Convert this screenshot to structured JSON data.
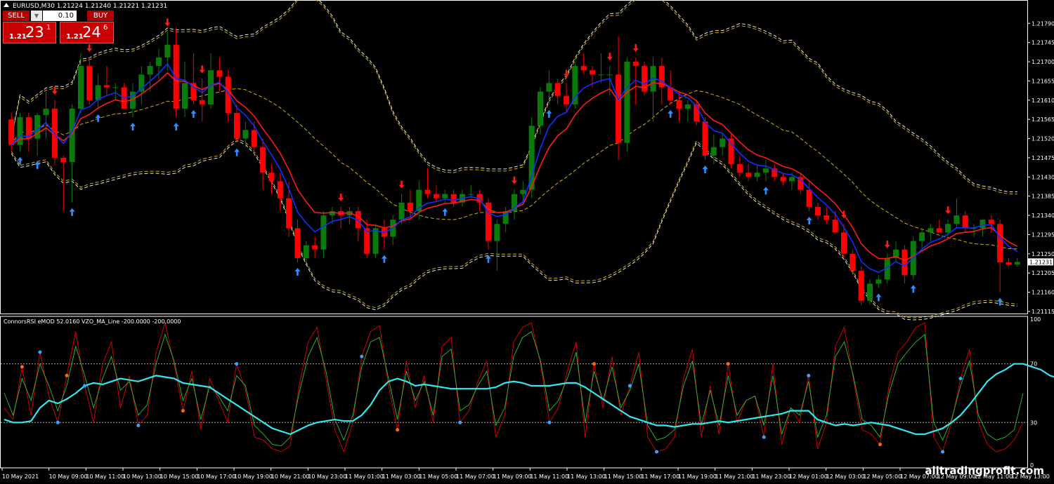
{
  "header": {
    "symbol_info": "EURUSD,M30  1.21224 1.21240 1.21221 1.21231",
    "indicator_info": "ConnorsRSI eMOD 52.0160  VZO_MA_Line -200.0000 -200.0000"
  },
  "trade_panel": {
    "sell_label": "SELL",
    "buy_label": "BUY",
    "lot": "0.10",
    "sell_small": "1.21",
    "sell_big": "23",
    "sell_sup": "1",
    "buy_small": "1.21",
    "buy_big": "24",
    "buy_sup": "6"
  },
  "current_price_label": "1.21231",
  "watermark": "alltradingprofit.com",
  "colors": {
    "bull": "#0a7a0a",
    "bear": "#ff0000",
    "ma_red": "#ff1a1a",
    "ma_blue": "#1030ff",
    "band_yellow": "#d4b000",
    "band_white": "#e8e8e8",
    "up_arrow": "#2f8fff",
    "down_arrow": "#ff1a1a",
    "vzo": "#33e6f0",
    "crsi_red": "#e00000",
    "crsi_green": "#2fbf2f"
  },
  "chart_data": [
    {
      "type": "candlestick",
      "price_axis": [
        "1.21790",
        "1.21745",
        "1.21700",
        "1.21655",
        "1.21610",
        "1.21565",
        "1.21520",
        "1.21475",
        "1.21430",
        "1.21385",
        "1.21340",
        "1.21295",
        "1.21250",
        "1.21205",
        "1.21160",
        "1.21115"
      ],
      "time_axis": [
        "10 May 2021",
        "10 May 09:00",
        "10 May 11:00",
        "10 May 13:00",
        "10 May 15:00",
        "10 May 17:00",
        "10 May 19:00",
        "10 May 21:00",
        "10 May 23:00",
        "11 May 01:00",
        "11 May 03:00",
        "11 May 05:00",
        "11 May 07:00",
        "11 May 09:00",
        "11 May 11:00",
        "11 May 13:00",
        "11 May 15:00",
        "11 May 17:00",
        "11 May 19:00",
        "11 May 21:00",
        "11 May 23:00",
        "12 May 01:00",
        "12 May 03:00",
        "12 May 05:00",
        "12 May 07:00",
        "12 May 09:00",
        "12 May 11:00",
        "12 May 13:00"
      ],
      "ylim": [
        1.2111,
        1.2182
      ],
      "candles": [
        [
          1.21565,
          1.2158,
          1.2149,
          1.21505
        ],
        [
          1.21505,
          1.2158,
          1.2149,
          1.2157
        ],
        [
          1.2157,
          1.2158,
          1.2149,
          1.2152
        ],
        [
          1.2152,
          1.2158,
          1.2148,
          1.21575
        ],
        [
          1.21575,
          1.2163,
          1.2152,
          1.2159
        ],
        [
          1.2159,
          1.2161,
          1.2146,
          1.21475
        ],
        [
          1.21475,
          1.2148,
          1.2135,
          1.21465
        ],
        [
          1.21465,
          1.216,
          1.2137,
          1.2159
        ],
        [
          1.2159,
          1.2172,
          1.2158,
          1.2169
        ],
        [
          1.2169,
          1.2171,
          1.216,
          1.2161
        ],
        [
          1.2161,
          1.2167,
          1.2159,
          1.21645
        ],
        [
          1.21645,
          1.2169,
          1.2162,
          1.2164
        ],
        [
          1.2164,
          1.2165,
          1.2161,
          1.2164
        ],
        [
          1.2164,
          1.2165,
          1.2159,
          1.2159
        ],
        [
          1.2159,
          1.2165,
          1.2157,
          1.2163
        ],
        [
          1.2163,
          1.2169,
          1.216,
          1.2167
        ],
        [
          1.2167,
          1.217,
          1.2163,
          1.2169
        ],
        [
          1.2169,
          1.2173,
          1.2166,
          1.2171
        ],
        [
          1.2171,
          1.2177,
          1.2168,
          1.2174
        ],
        [
          1.2174,
          1.2178,
          1.2157,
          1.2159
        ],
        [
          1.2159,
          1.217,
          1.2157,
          1.2165
        ],
        [
          1.2165,
          1.2172,
          1.216,
          1.2161
        ],
        [
          1.2161,
          1.2166,
          1.2156,
          1.216
        ],
        [
          1.216,
          1.2172,
          1.2159,
          1.2168
        ],
        [
          1.2168,
          1.2171,
          1.2163,
          1.21665
        ],
        [
          1.21665,
          1.2168,
          1.2156,
          1.2158
        ],
        [
          1.2158,
          1.216,
          1.2151,
          1.2152
        ],
        [
          1.2152,
          1.2156,
          1.215,
          1.2154
        ],
        [
          1.2154,
          1.2156,
          1.2148,
          1.215
        ],
        [
          1.215,
          1.2152,
          1.214,
          1.2144
        ],
        [
          1.2144,
          1.2146,
          1.2139,
          1.2142
        ],
        [
          1.2142,
          1.2144,
          1.2135,
          1.2138
        ],
        [
          1.2138,
          1.2142,
          1.2129,
          1.2131
        ],
        [
          1.2131,
          1.2133,
          1.2123,
          1.2124
        ],
        [
          1.2124,
          1.2128,
          1.2123,
          1.2127
        ],
        [
          1.2127,
          1.2129,
          1.2124,
          1.2126
        ],
        [
          1.2126,
          1.2135,
          1.2124,
          1.2134
        ],
        [
          1.2134,
          1.2136,
          1.2132,
          1.2135
        ],
        [
          1.2135,
          1.2136,
          1.2131,
          1.2134
        ],
        [
          1.2134,
          1.2136,
          1.2132,
          1.2135
        ],
        [
          1.2135,
          1.2136,
          1.2128,
          1.2131
        ],
        [
          1.2131,
          1.2133,
          1.2124,
          1.2125
        ],
        [
          1.2125,
          1.2132,
          1.2124,
          1.2131
        ],
        [
          1.2131,
          1.2133,
          1.2126,
          1.2129
        ],
        [
          1.2129,
          1.2134,
          1.2127,
          1.2133
        ],
        [
          1.2133,
          1.2139,
          1.2132,
          1.2137
        ],
        [
          1.2137,
          1.214,
          1.2133,
          1.2135
        ],
        [
          1.2135,
          1.2142,
          1.2133,
          1.214
        ],
        [
          1.214,
          1.2145,
          1.2138,
          1.2139
        ],
        [
          1.2139,
          1.2141,
          1.2137,
          1.2138
        ],
        [
          1.2138,
          1.214,
          1.2137,
          1.2139
        ],
        [
          1.2139,
          1.214,
          1.2136,
          1.2137
        ],
        [
          1.2137,
          1.214,
          1.2136,
          1.2139
        ],
        [
          1.2139,
          1.2141,
          1.2138,
          1.2139
        ],
        [
          1.2139,
          1.214,
          1.2135,
          1.2137
        ],
        [
          1.2137,
          1.2138,
          1.2126,
          1.2128
        ],
        [
          1.2128,
          1.2133,
          1.2121,
          1.2132
        ],
        [
          1.2132,
          1.2136,
          1.213,
          1.2135
        ],
        [
          1.2135,
          1.214,
          1.2133,
          1.2139
        ],
        [
          1.2139,
          1.2142,
          1.2137,
          1.214
        ],
        [
          1.214,
          1.2157,
          1.2138,
          1.2155
        ],
        [
          1.2155,
          1.2164,
          1.2153,
          1.2163
        ],
        [
          1.2163,
          1.2168,
          1.216,
          1.2165
        ],
        [
          1.2165,
          1.2166,
          1.216,
          1.2162
        ],
        [
          1.2162,
          1.2165,
          1.2158,
          1.216
        ],
        [
          1.216,
          1.217,
          1.2159,
          1.2169
        ],
        [
          1.2169,
          1.2172,
          1.2167,
          1.2168
        ],
        [
          1.2168,
          1.2169,
          1.2164,
          1.2167
        ],
        [
          1.2167,
          1.2172,
          1.2165,
          1.2167
        ],
        [
          1.2167,
          1.2169,
          1.2162,
          1.2167
        ],
        [
          1.2167,
          1.2176,
          1.2147,
          1.2151
        ],
        [
          1.2151,
          1.2171,
          1.2149,
          1.217
        ],
        [
          1.217,
          1.2171,
          1.216,
          1.2169
        ],
        [
          1.2169,
          1.217,
          1.2162,
          1.2163
        ],
        [
          1.2163,
          1.2171,
          1.2156,
          1.2169
        ],
        [
          1.2169,
          1.2171,
          1.216,
          1.2164
        ],
        [
          1.2164,
          1.2168,
          1.216,
          1.2161
        ],
        [
          1.2161,
          1.2163,
          1.2156,
          1.2159
        ],
        [
          1.2159,
          1.2161,
          1.2156,
          1.216
        ],
        [
          1.216,
          1.2161,
          1.2155,
          1.2156
        ],
        [
          1.2156,
          1.2157,
          1.2147,
          1.2148
        ],
        [
          1.2148,
          1.2153,
          1.2146,
          1.215
        ],
        [
          1.215,
          1.2153,
          1.2148,
          1.2152
        ],
        [
          1.2152,
          1.2153,
          1.2145,
          1.2146
        ],
        [
          1.2146,
          1.2148,
          1.2143,
          1.2144
        ],
        [
          1.2144,
          1.2146,
          1.2142,
          1.2143
        ],
        [
          1.2143,
          1.2146,
          1.2142,
          1.2144
        ],
        [
          1.2144,
          1.2147,
          1.2142,
          1.2145
        ],
        [
          1.2145,
          1.2146,
          1.2142,
          1.2143
        ],
        [
          1.2143,
          1.2144,
          1.2141,
          1.2142
        ],
        [
          1.2142,
          1.2144,
          1.214,
          1.2143
        ],
        [
          1.2143,
          1.2144,
          1.2139,
          1.214
        ],
        [
          1.214,
          1.2142,
          1.2135,
          1.2136
        ],
        [
          1.2136,
          1.2137,
          1.2133,
          1.2134
        ],
        [
          1.2134,
          1.2136,
          1.2132,
          1.2133
        ],
        [
          1.2133,
          1.2135,
          1.2132,
          1.213
        ],
        [
          1.213,
          1.2132,
          1.2124,
          1.2125
        ],
        [
          1.2125,
          1.2126,
          1.212,
          1.2121
        ],
        [
          1.2121,
          1.2122,
          1.2113,
          1.2114
        ],
        [
          1.2114,
          1.2119,
          1.2113,
          1.2118
        ],
        [
          1.2118,
          1.212,
          1.2117,
          1.2119
        ],
        [
          1.2119,
          1.2125,
          1.2118,
          1.2124
        ],
        [
          1.2124,
          1.2128,
          1.2123,
          1.2126
        ],
        [
          1.2126,
          1.2127,
          1.2118,
          1.212
        ],
        [
          1.212,
          1.2129,
          1.2119,
          1.2128
        ],
        [
          1.2128,
          1.2131,
          1.2126,
          1.213
        ],
        [
          1.213,
          1.2132,
          1.2128,
          1.2131
        ],
        [
          1.2131,
          1.2133,
          1.213,
          1.213
        ],
        [
          1.213,
          1.2133,
          1.2129,
          1.2132
        ],
        [
          1.2132,
          1.2138,
          1.2131,
          1.2134
        ],
        [
          1.2134,
          1.2135,
          1.213,
          1.2131
        ],
        [
          1.2131,
          1.2132,
          1.2129,
          1.2131
        ],
        [
          1.2131,
          1.2133,
          1.2129,
          1.2133
        ],
        [
          1.2133,
          1.2134,
          1.213,
          1.2132
        ],
        [
          1.2132,
          1.2133,
          1.2116,
          1.2123
        ],
        [
          1.2123,
          1.2124,
          1.2122,
          1.21225
        ],
        [
          1.21225,
          1.2124,
          1.2122,
          1.21231
        ]
      ],
      "up_arrows_idx": [
        1,
        3,
        7,
        10,
        14,
        19,
        21,
        26,
        33,
        43,
        50,
        55,
        62,
        76,
        80,
        87,
        92,
        100,
        104,
        114
      ],
      "down_arrows_idx": [
        5,
        9,
        18,
        22,
        38,
        45,
        58,
        64,
        69,
        72,
        96,
        101,
        108
      ]
    },
    {
      "type": "line",
      "ylim": [
        0,
        100
      ],
      "levels": [
        30,
        70
      ],
      "y_axis_labels": [
        "100",
        "70",
        "30",
        "0"
      ],
      "series": [
        {
          "values": [
            40,
            32,
            68,
            35,
            78,
            48,
            30,
            62,
            92,
            55,
            30,
            70,
            85,
            40,
            62,
            28,
            35,
            78,
            98,
            70,
            38,
            65,
            25,
            60,
            45,
            30,
            70,
            52,
            20,
            18,
            12,
            10,
            14,
            55,
            85,
            95,
            60,
            25,
            10,
            30,
            75,
            92,
            96,
            55,
            25,
            72,
            40,
            62,
            30,
            82,
            88,
            30,
            38,
            58,
            72,
            20,
            35,
            85,
            95,
            98,
            70,
            30,
            40,
            65,
            85,
            20,
            70,
            40,
            75,
            35,
            55,
            78,
            20,
            10,
            12,
            20,
            60,
            80,
            20,
            55,
            22,
            70,
            30,
            45,
            48,
            20,
            70,
            15,
            40,
            30,
            62,
            12,
            30,
            82,
            95,
            60,
            25,
            22,
            15,
            55,
            78,
            85,
            95,
            98,
            20,
            10,
            30,
            60,
            80,
            30,
            15,
            10,
            12,
            18,
            30
          ]
        },
        {
          "values": [
            50,
            35,
            60,
            45,
            70,
            55,
            38,
            55,
            82,
            62,
            40,
            60,
            75,
            52,
            58,
            35,
            42,
            70,
            90,
            72,
            45,
            60,
            32,
            55,
            48,
            38,
            62,
            55,
            28,
            22,
            15,
            14,
            20,
            50,
            75,
            88,
            65,
            32,
            18,
            35,
            68,
            85,
            88,
            60,
            32,
            65,
            45,
            58,
            35,
            75,
            80,
            38,
            42,
            55,
            65,
            28,
            40,
            75,
            88,
            92,
            72,
            38,
            45,
            60,
            78,
            30,
            65,
            45,
            68,
            40,
            52,
            70,
            28,
            18,
            20,
            25,
            55,
            72,
            28,
            52,
            28,
            62,
            35,
            45,
            48,
            28,
            62,
            22,
            40,
            35,
            58,
            20,
            35,
            75,
            85,
            62,
            32,
            28,
            20,
            50,
            70,
            78,
            85,
            90,
            30,
            18,
            32,
            55,
            72,
            35,
            22,
            18,
            20,
            25,
            50
          ]
        },
        {
          "values": [
            32,
            30,
            30,
            31,
            40,
            45,
            43,
            46,
            50,
            55,
            57,
            56,
            58,
            60,
            59,
            58,
            60,
            62,
            61,
            60,
            57,
            56,
            55,
            54,
            50,
            46,
            42,
            38,
            34,
            30,
            26,
            24,
            22,
            25,
            28,
            30,
            31,
            32,
            31,
            31,
            35,
            42,
            52,
            58,
            60,
            58,
            55,
            56,
            55,
            54,
            53,
            53,
            53,
            53,
            53,
            54,
            57,
            58,
            57,
            55,
            55,
            55,
            56,
            57,
            57,
            54,
            50,
            46,
            42,
            38,
            34,
            32,
            30,
            28,
            28,
            27,
            28,
            29,
            29,
            30,
            31,
            30,
            31,
            32,
            33,
            34,
            35,
            36,
            38,
            38,
            38,
            32,
            30,
            28,
            29,
            28,
            29,
            30,
            29,
            28,
            26,
            24,
            22,
            22,
            24,
            26,
            30,
            35,
            42,
            50,
            58,
            63,
            66,
            70,
            70,
            68,
            66,
            62,
            60
          ]
        }
      ],
      "markers_idx": [
        2,
        4,
        6,
        7,
        9,
        15,
        20,
        26,
        40,
        44,
        51,
        61,
        66,
        70,
        73,
        81,
        85,
        90,
        98,
        105,
        107
      ]
    }
  ]
}
